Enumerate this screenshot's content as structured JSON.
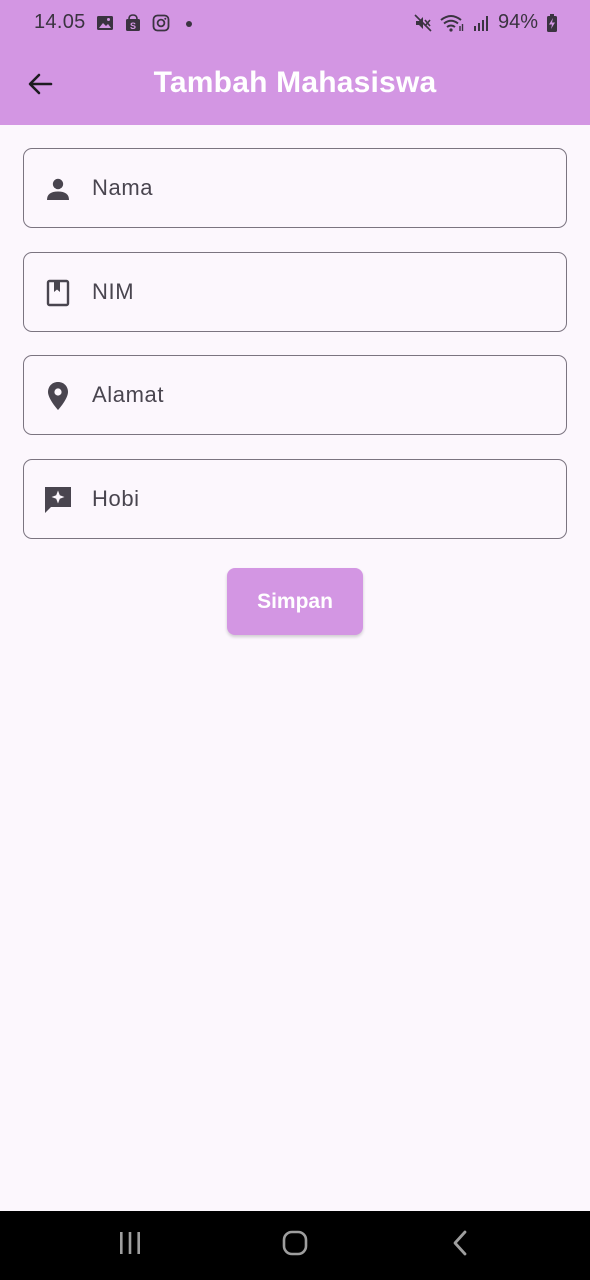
{
  "colors": {
    "accent": "#d396e3",
    "background": "#fcf7fd",
    "field_border": "#7b7480",
    "text": "#49454f"
  },
  "status_bar": {
    "time": "14.05",
    "notification_icons": [
      "image-icon",
      "shop-bag-icon",
      "instagram-icon",
      "dot-icon"
    ],
    "system_icons": [
      "mute-icon",
      "wifi-icon",
      "signal-icon"
    ],
    "battery": "94%"
  },
  "app_bar": {
    "back_icon": "arrow-left-icon",
    "title": "Tambah Mahasiswa"
  },
  "form": {
    "fields": [
      {
        "icon": "person-icon",
        "placeholder": "Nama",
        "value": ""
      },
      {
        "icon": "book-icon",
        "placeholder": "NIM",
        "value": ""
      },
      {
        "icon": "location-pin-icon",
        "placeholder": "Alamat",
        "value": ""
      },
      {
        "icon": "chat-sparkle-icon",
        "placeholder": "Hobi",
        "value": ""
      }
    ],
    "submit_label": "Simpan"
  },
  "nav_bar": {
    "items": [
      "recent-apps-icon",
      "home-icon",
      "back-chevron-icon"
    ]
  }
}
